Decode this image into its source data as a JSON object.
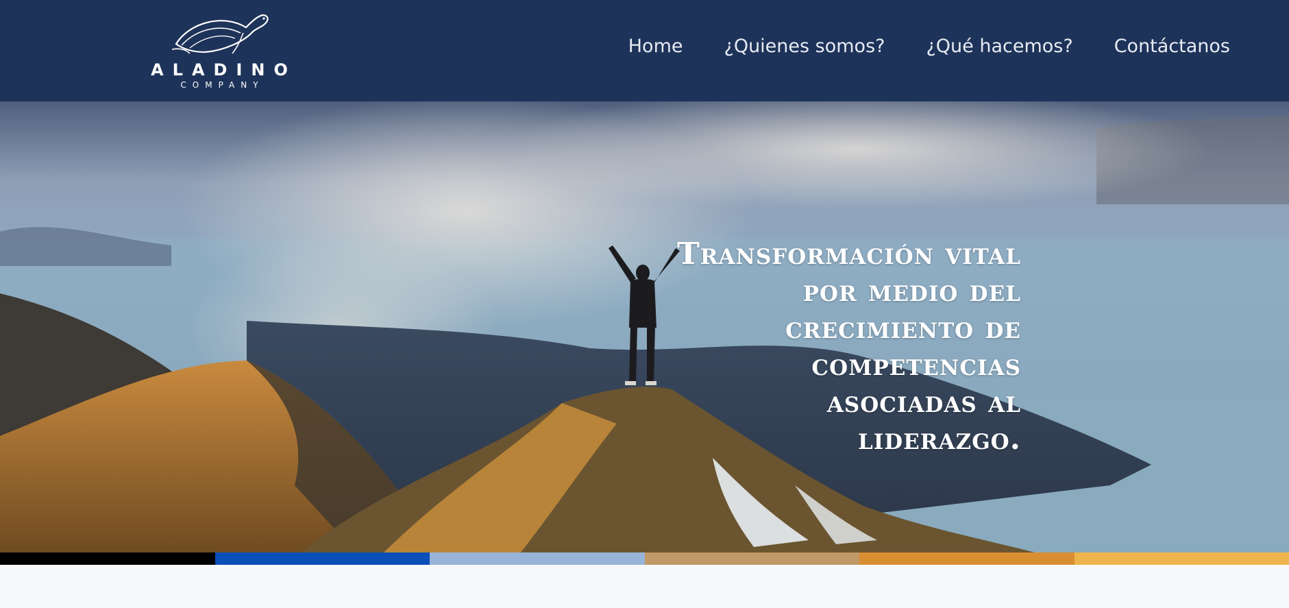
{
  "brand": {
    "name": "ALADINO",
    "subtitle": "COMPANY",
    "logo_icon": "turtle-logo-icon"
  },
  "nav": {
    "items": [
      {
        "label": "Home"
      },
      {
        "label": "¿Quienes somos?"
      },
      {
        "label": "¿Qué hacemos?"
      },
      {
        "label": "Contáctanos"
      }
    ]
  },
  "hero": {
    "headline": "Transformación vital por medio del crecimiento de competencias asociadas al liderazgo."
  },
  "colors": {
    "navbar": "#1e3359",
    "stripes": [
      "#000000",
      "#0b4fb8",
      "#97b4d8",
      "#c19a68",
      "#d98e32",
      "#eeb54c"
    ]
  }
}
